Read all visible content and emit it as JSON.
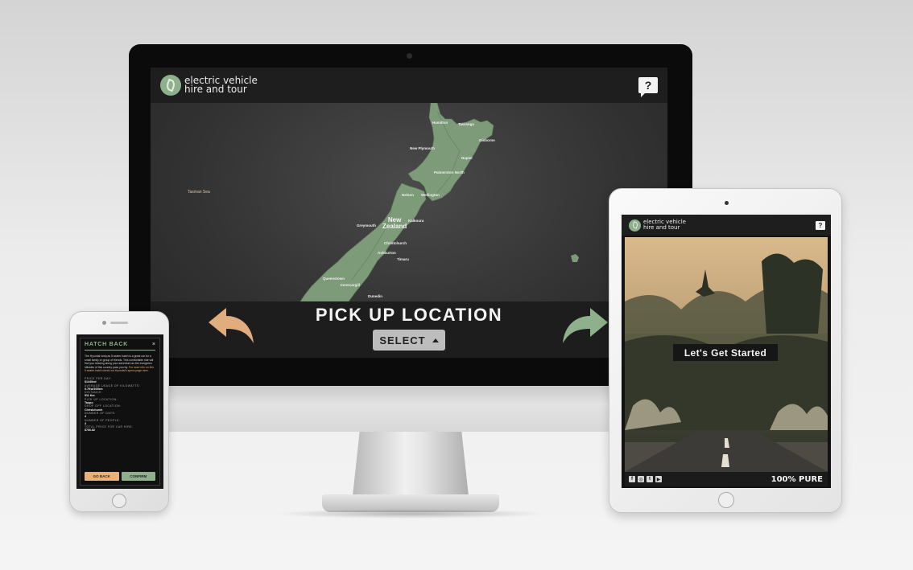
{
  "brand": {
    "line1": "electric vehicle",
    "line2": "hire and tour",
    "help_label": "?",
    "accent": "#8fb08c",
    "secondary": "#e8b07a"
  },
  "desktop": {
    "title": "PICK UP LOCATION",
    "select_label": "SELECT",
    "back_arrow_icon": "back-arrow-icon",
    "next_arrow_icon": "next-arrow-icon",
    "map": {
      "sea_label": "Tasman Sea",
      "country_label_line1": "New",
      "country_label_line2": "Zealand",
      "cities": [
        "Hamilton",
        "Tauranga",
        "New Plymouth",
        "Gisborne",
        "Napier",
        "Palmerston North",
        "Wellington",
        "Nelson",
        "Kaikoura",
        "Greymouth",
        "Christchurch",
        "Ashburton",
        "Timaru",
        "Queenstown",
        "Invercargill",
        "Dunedin"
      ]
    }
  },
  "mobile": {
    "modal_title": "HATCH BACK",
    "close_label": "×",
    "description": "The Hyundai Ioniq as 5 seater hatch is a great car for a small family or group of friends. This comfortable ride will find you relaxing along your adventure as the evergreen hillsides of this country pass you by.",
    "link_text": "For more info on this 5 seater hatch check out Hyundai's specs page here.",
    "specs": [
      {
        "label": "PRICE PER DAY:",
        "value": "$144/hot"
      },
      {
        "label": "AVERAGE USAGE OF KILOWATTS:",
        "value": "9.7Kw/100km"
      },
      {
        "label": "DISTANCE:",
        "value": "511 Km"
      },
      {
        "label": "PICK UP LOCATION:",
        "value": "Taupo"
      },
      {
        "label": "DROP OFF LOCATION:",
        "value": "Christchurch"
      },
      {
        "label": "NUMBER OF DAYS:",
        "value": "4"
      },
      {
        "label": "NUMBER OF PEOPLE:",
        "value": "4"
      },
      {
        "label": "TOTAL PRICE FOR CAR HIRE:",
        "value": "$766.82"
      }
    ],
    "back_label": "GO BACK",
    "confirm_label": "CONFIRM"
  },
  "tablet": {
    "start_label": "Let's Get Started",
    "footer_badge": "100% PURE",
    "social_icons": [
      "facebook-icon",
      "instagram-icon",
      "twitter-icon",
      "youtube-icon"
    ]
  }
}
